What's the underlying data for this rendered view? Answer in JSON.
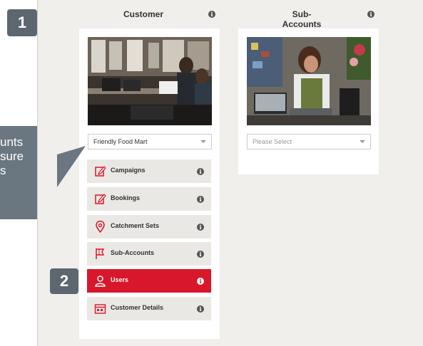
{
  "steps": {
    "step1": "1",
    "step2": "2"
  },
  "callout": {
    "line1": "unts",
    "line2": "sure",
    "line3": "s"
  },
  "customer": {
    "title": "Customer",
    "select_value": "Friendly Food Mart",
    "menu": [
      {
        "label": "Campaigns",
        "icon": "edit-icon"
      },
      {
        "label": "Bookings",
        "icon": "edit-icon"
      },
      {
        "label": "Catchment Sets",
        "icon": "location-pin-icon"
      },
      {
        "label": "Sub-Accounts",
        "icon": "flag-icon"
      },
      {
        "label": "Users",
        "icon": "user-icon",
        "active": true
      },
      {
        "label": "Customer Details",
        "icon": "calendar-icon"
      }
    ]
  },
  "subaccounts": {
    "title": "Sub-Accounts",
    "select_placeholder": "Please Select"
  },
  "colors": {
    "accent": "#d9172a",
    "badge": "#5d6770",
    "background": "#f0efec"
  }
}
